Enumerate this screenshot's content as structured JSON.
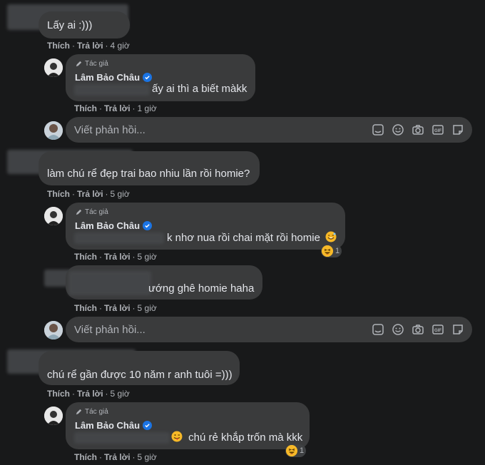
{
  "labels": {
    "like": "Thích",
    "reply": "Trả lời",
    "author_tag": "Tác giả",
    "reply_placeholder": "Viết phản hồi..."
  },
  "author": {
    "name": "Lâm Bảo Châu"
  },
  "comments": [
    {
      "text": "Lấy ai :)))",
      "time": "4 giờ"
    },
    {
      "text": "ấy ai thì a biết màkk",
      "time": "1 giờ",
      "is_author": true
    },
    {
      "text": "làm chú rể đẹp trai bao nhiu lần rồi homie?",
      "time": "5 giờ"
    },
    {
      "text": "k nhơ nua rồi chai mặt rồi homie",
      "time": "5 giờ",
      "is_author": true,
      "reaction_count": "1"
    },
    {
      "text": "ướng ghê homie haha",
      "time": "5 giờ"
    },
    {
      "text": "chú rể gần được 10 năm r anh tuôi =)))",
      "time": "5 giờ"
    },
    {
      "text": "chú rẻ khắp trốn mà kkk",
      "time": "5 giờ",
      "is_author": true,
      "reaction_count": "1"
    }
  ],
  "colors": {
    "background": "#18191a",
    "bubble": "#3a3b3c",
    "muted_text": "#b0b3b8",
    "verified": "#1b74e4"
  }
}
